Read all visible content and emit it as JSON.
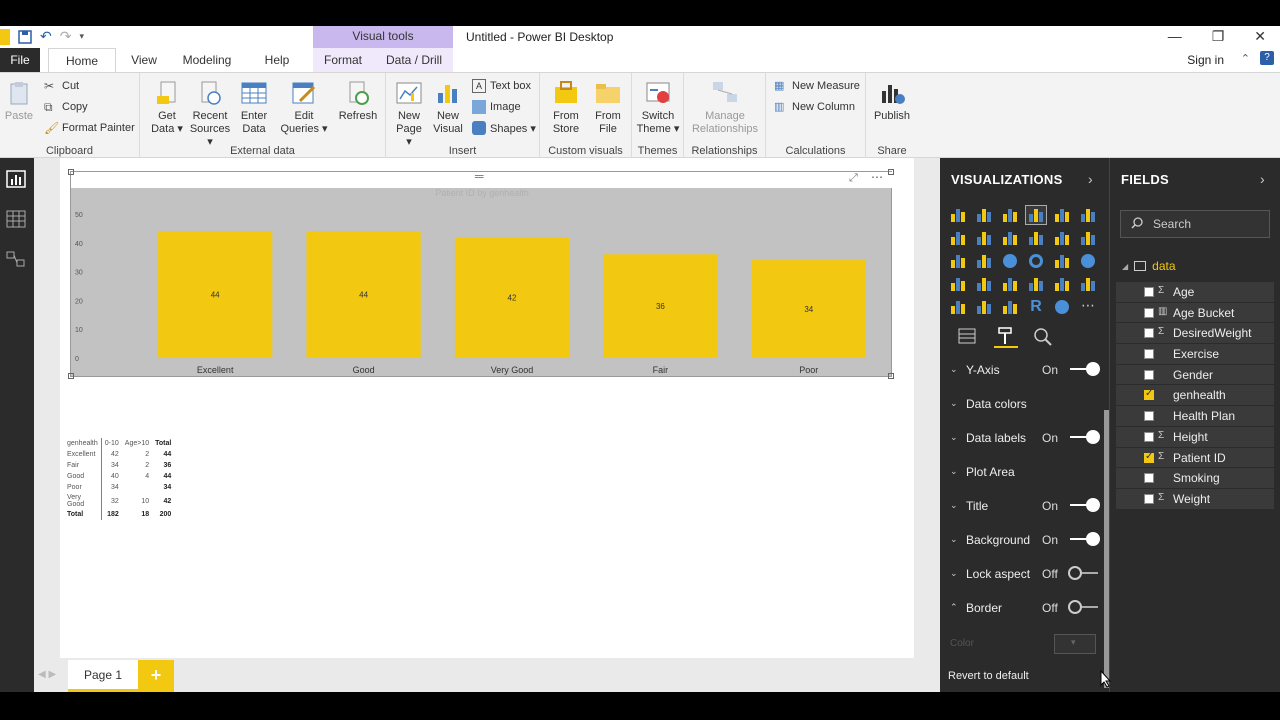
{
  "window": {
    "title": "Untitled - Power BI Desktop",
    "context_tab": "Visual tools",
    "sign_in": "Sign in"
  },
  "tabs": {
    "file": "File",
    "home": "Home",
    "view": "View",
    "modeling": "Modeling",
    "help": "Help",
    "format": "Format",
    "data_drill": "Data / Drill"
  },
  "ribbon": {
    "clipboard": {
      "label": "Clipboard",
      "paste": "Paste",
      "cut": "Cut",
      "copy": "Copy",
      "format_painter": "Format Painter"
    },
    "external_data": {
      "label": "External data",
      "get_data": "Get Data ▾",
      "get_data_l1": "Get",
      "get_data_l2": "Data ▾",
      "recent_l1": "Recent",
      "recent_l2": "Sources ▾",
      "enter_l1": "Enter",
      "enter_l2": "Data",
      "edit_l1": "Edit",
      "edit_l2": "Queries ▾",
      "refresh": "Refresh"
    },
    "insert": {
      "label": "Insert",
      "new_page_l1": "New",
      "new_page_l2": "Page ▾",
      "new_visual_l1": "New",
      "new_visual_l2": "Visual",
      "text_box": "Text box",
      "image": "Image",
      "shapes": "Shapes ▾"
    },
    "custom_visuals": {
      "label": "Custom visuals",
      "from_store_l1": "From",
      "from_store_l2": "Store",
      "from_file_l1": "From",
      "from_file_l2": "File"
    },
    "themes": {
      "label": "Themes",
      "switch_l1": "Switch",
      "switch_l2": "Theme ▾"
    },
    "relationships": {
      "label": "Relationships",
      "manage_l1": "Manage",
      "manage_l2": "Relationships"
    },
    "calculations": {
      "label": "Calculations",
      "new_measure": "New Measure",
      "new_column": "New Column"
    },
    "share": {
      "label": "Share",
      "publish": "Publish"
    }
  },
  "chart_data": {
    "type": "bar",
    "title": "Patient ID by genhealth",
    "categories": [
      "Excellent",
      "Good",
      "Very Good",
      "Fair",
      "Poor"
    ],
    "values": [
      44,
      44,
      42,
      36,
      34
    ],
    "data_labels": [
      "44",
      "44",
      "42",
      "36",
      "34"
    ],
    "ylim": [
      0,
      50
    ],
    "yticks": [
      "50",
      "40",
      "30",
      "20",
      "10",
      "0"
    ],
    "color": "#F2C811",
    "background": "#C2C2C2"
  },
  "matrix": {
    "headers": [
      "genhealth",
      "0-10",
      "Age>10",
      "Total"
    ],
    "rows": [
      [
        "Excellent",
        "42",
        "2",
        "44"
      ],
      [
        "Fair",
        "34",
        "2",
        "36"
      ],
      [
        "Good",
        "40",
        "4",
        "44"
      ],
      [
        "Poor",
        "34",
        "",
        "34"
      ],
      [
        "Very Good",
        "32",
        "10",
        "42"
      ],
      [
        "Total",
        "182",
        "18",
        "200"
      ]
    ]
  },
  "pages": {
    "page1": "Page 1",
    "add": "+"
  },
  "visualizations": {
    "header": "VISUALIZATIONS",
    "properties": [
      {
        "name": "Y-Axis",
        "state": "On",
        "toggle": "on",
        "chev": "⌄"
      },
      {
        "name": "Data colors",
        "state": "",
        "toggle": "",
        "chev": "⌄"
      },
      {
        "name": "Data labels",
        "state": "On",
        "toggle": "on",
        "chev": "⌄"
      },
      {
        "name": "Plot Area",
        "state": "",
        "toggle": "",
        "chev": "⌄"
      },
      {
        "name": "Title",
        "state": "On",
        "toggle": "on",
        "chev": "⌄"
      },
      {
        "name": "Background",
        "state": "On",
        "toggle": "on",
        "chev": "⌄"
      },
      {
        "name": "Lock aspect",
        "state": "Off",
        "toggle": "off",
        "chev": "⌄"
      },
      {
        "name": "Border",
        "state": "Off",
        "toggle": "off",
        "chev": "⌃"
      }
    ],
    "color_label": "Color",
    "revert": "Revert to default"
  },
  "fields": {
    "header": "FIELDS",
    "search_placeholder": "Search",
    "table": "data",
    "items": [
      {
        "name": "Age",
        "sigma": "Σ",
        "checked": false
      },
      {
        "name": "Age Bucket",
        "sigma": "▥",
        "checked": false
      },
      {
        "name": "DesiredWeight",
        "sigma": "Σ",
        "checked": false
      },
      {
        "name": "Exercise",
        "sigma": "",
        "checked": false
      },
      {
        "name": "Gender",
        "sigma": "",
        "checked": false
      },
      {
        "name": "genhealth",
        "sigma": "",
        "checked": true
      },
      {
        "name": "Health Plan",
        "sigma": "",
        "checked": false
      },
      {
        "name": "Height",
        "sigma": "Σ",
        "checked": false
      },
      {
        "name": "Patient ID",
        "sigma": "Σ",
        "checked": true
      },
      {
        "name": "Smoking",
        "sigma": "",
        "checked": false
      },
      {
        "name": "Weight",
        "sigma": "Σ",
        "checked": false
      }
    ]
  }
}
